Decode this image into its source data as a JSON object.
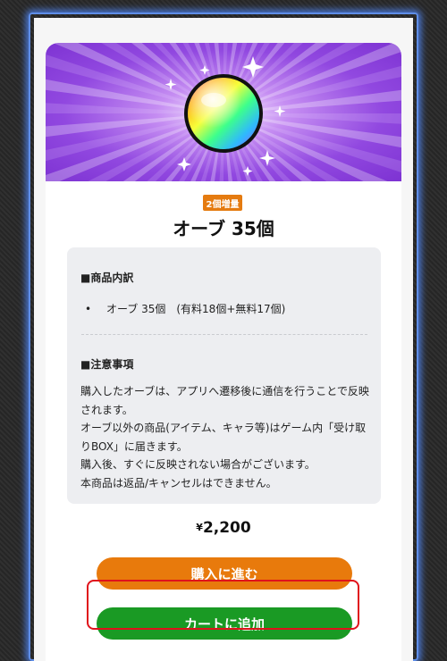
{
  "product": {
    "badge": "2個増量",
    "title": "オーブ 35個"
  },
  "details": {
    "contents_heading": "■商品内訳",
    "bullet": "•",
    "contents_item": "オーブ 35個　(有料18個+無料17個)",
    "notes_heading": "■注意事項",
    "notes_lines": [
      "購入したオーブは、アプリへ遷移後に通信を行うことで反映",
      "されます。",
      "オーブ以外の商品(アイテム、キャラ等)はゲーム内「受け取",
      "りBOX」に届きます。",
      "購入後、すぐに反映されない場合がございます。",
      "本商品は返品/キャンセルはできません。"
    ]
  },
  "price": {
    "currency": "¥",
    "amount": "2,200"
  },
  "actions": {
    "buy_label": "購入に進む",
    "cart_label": "カートに追加"
  },
  "colors": {
    "buy_button": "#e87a0c",
    "cart_button": "#1a9a24",
    "badge": "#e57b10",
    "highlight": "#e0121b",
    "banner_purple": "#8a3fd6"
  },
  "icons": {
    "banner": "rainbow-orb-icon"
  }
}
